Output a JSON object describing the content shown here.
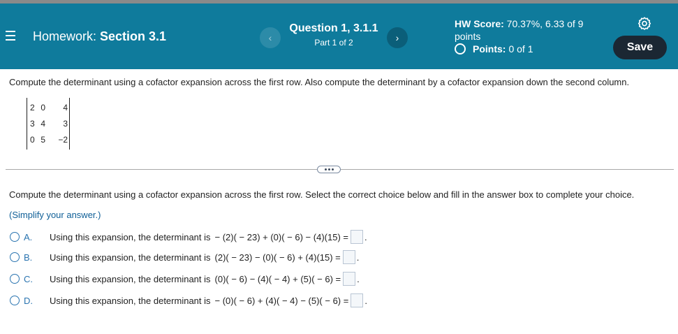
{
  "header": {
    "title_prefix": "Homework: ",
    "title_section": "Section 3.1",
    "question_title": "Question 1, 3.1.1",
    "question_part": "Part 1 of 2",
    "prev_label": "‹",
    "next_label": "›",
    "score_label": "HW Score:",
    "score_value": " 70.37%, 6.33 of 9 points",
    "points_label": "Points:",
    "points_value": "0 of 1",
    "save_label": "Save"
  },
  "problem": {
    "prompt": "Compute the determinant using a cofactor expansion across the first row. Also compute the determinant by a cofactor expansion down the second column.",
    "matrix": [
      [
        "2",
        "0",
        "4"
      ],
      [
        "3",
        "4",
        "3"
      ],
      [
        "0",
        "5",
        "−2"
      ]
    ]
  },
  "part": {
    "prompt": "Compute the determinant using a cofactor expansion across the first row. Select the correct choice below and fill in the answer box to complete your choice.",
    "simplify": "(Simplify your answer.)",
    "choice_text": "Using this expansion, the determinant is",
    "choices": [
      {
        "letter": "A.",
        "expr": "− (2)( − 23) + (0)( − 6) − (4)(15) ="
      },
      {
        "letter": "B.",
        "expr": "(2)( − 23) − (0)( − 6) + (4)(15) ="
      },
      {
        "letter": "C.",
        "expr": "(0)( − 6) − (4)( − 4) + (5)( − 6) ="
      },
      {
        "letter": "D.",
        "expr": "− (0)( − 6) + (4)( − 4) − (5)( − 6) ="
      }
    ],
    "answer_suffix": "."
  },
  "colors": {
    "header_bg": "#0f7b9c",
    "save_bg": "#1b2733",
    "choice_accent": "#2a74b0",
    "simplify_text": "#0f5f97"
  }
}
